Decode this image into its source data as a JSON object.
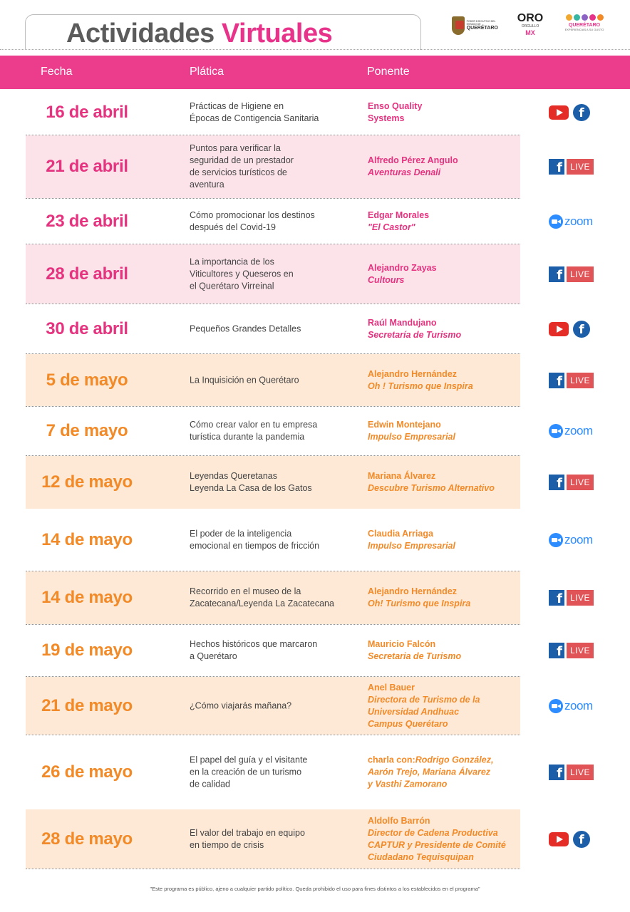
{
  "header": {
    "title_word1": "Actividades",
    "title_word2": "Virtuales",
    "logos": [
      {
        "name": "queretaro-gobierno-logo",
        "line1": "PODER EJECUTIVO DEL ESTADO DE",
        "line2": "QUERÉTARO"
      },
      {
        "name": "oro-orgullo-mx-logo",
        "line1": "ORO",
        "line2": "ORGULLO",
        "line3": "MX"
      },
      {
        "name": "queretaro-turismo-logo",
        "line1": "QUERÉTARO",
        "line2": "EXPERIENCIAS A SU GUSTO"
      }
    ]
  },
  "columns": {
    "fecha": "Fecha",
    "platica": "Plática",
    "ponente": "Ponente"
  },
  "colors": {
    "pink": "#ec3c8c",
    "orange": "#f28a28",
    "pink_bg": "#fce3ea",
    "orange_bg": "#fee9d6"
  },
  "rows": [
    {
      "date": "16 de abril",
      "talk": "Prácticas de Higiene en\nÉpocas de Contigencia Sanitaria",
      "speaker": [
        "Enso Quality",
        "Systems"
      ],
      "org": "",
      "platform": [
        "youtube-icon",
        "facebook-icon"
      ]
    },
    {
      "date": "21 de abril",
      "talk": "Puntos para verificar la\nseguridad de un prestador\nde servicios turísticos de\naventura",
      "speaker": [
        "Alfredo Pérez Angulo"
      ],
      "org": "Aventuras Denali",
      "platform": [
        "facebook-live-icon"
      ]
    },
    {
      "date": "23 de abril",
      "talk": "Cómo promocionar los destinos\ndespués del Covid-19",
      "speaker": [
        "Edgar Morales"
      ],
      "org": "\"El Castor\"",
      "platform": [
        "zoom-icon"
      ]
    },
    {
      "date": "28 de abril",
      "talk": "La importancia de los\nViticultores y Queseros en\nel Querétaro Virreinal",
      "speaker": [
        "Alejandro Zayas"
      ],
      "org": "Cultours",
      "platform": [
        "facebook-live-icon"
      ]
    },
    {
      "date": "30 de abril",
      "talk": "Pequeños Grandes Detalles",
      "speaker": [
        "Raúl Mandujano"
      ],
      "org": "Secretaría de Turismo",
      "platform": [
        "youtube-icon",
        "facebook-icon"
      ]
    },
    {
      "date": "5 de mayo",
      "talk": "La Inquisición en Querétaro",
      "speaker": [
        "Alejandro Hernández"
      ],
      "org": "Oh ! Turismo que Inspira",
      "platform": [
        "facebook-live-icon"
      ]
    },
    {
      "date": "7 de mayo",
      "talk": "Cómo crear valor en tu empresa\nturística durante la pandemia",
      "speaker": [
        "Edwin Montejano"
      ],
      "org": "Impulso Empresarial",
      "platform": [
        "zoom-icon"
      ]
    },
    {
      "date": "12 de mayo",
      "talk": "Leyendas Queretanas\nLeyenda La Casa de los Gatos",
      "speaker": [
        "Mariana Álvarez"
      ],
      "org": "Descubre Turismo Alternativo",
      "platform": [
        "facebook-live-icon"
      ]
    },
    {
      "date": "14 de mayo",
      "talk": "El poder de la inteligencia\nemocional en tiempos de fricción",
      "speaker": [
        "Claudia Arriaga"
      ],
      "org": "Impulso Empresarial",
      "platform": [
        "zoom-icon"
      ]
    },
    {
      "date": "14 de mayo",
      "talk": "Recorrido en el museo de la\nZacatecana/Leyenda La Zacatecana",
      "speaker": [
        "Alejandro Hernández"
      ],
      "org": "Oh! Turismo que Inspira",
      "platform": [
        "facebook-live-icon"
      ]
    },
    {
      "date": "19 de mayo",
      "talk": "Hechos históricos que marcaron\na Querétaro",
      "speaker": [
        "Mauricio Falcón"
      ],
      "org": "Secretaria de Turismo",
      "platform": [
        "facebook-live-icon"
      ]
    },
    {
      "date": "21 de mayo",
      "talk": "¿Cómo viajarás mañana?",
      "speaker": [
        "Anel Bauer"
      ],
      "org": "Directora de Turismo de la\nUniversidad Andhuac\nCampus Querétaro",
      "platform": [
        "zoom-icon"
      ]
    },
    {
      "date": "26 de mayo",
      "talk": "El papel del guía y el visitante\nen la creación de un turismo\nde calidad",
      "speaker": [
        "charla con:"
      ],
      "org": "Rodrigo González,\nAarón Trejo, Mariana Álvarez\ny Vasthi Zamorano",
      "platform": [
        "facebook-live-icon"
      ]
    },
    {
      "date": "28 de mayo",
      "talk": "El valor del trabajo en equipo\nen tiempo de crisis",
      "speaker": [
        "Aldolfo Barrón"
      ],
      "org": "Director de Cadena Productiva\nCAPTUR y Presidente de Comité\nCiudadano Tequisquipan",
      "platform": [
        "youtube-icon",
        "facebook-icon"
      ]
    }
  ],
  "platform_labels": {
    "live": "LIVE",
    "zoom": "zoom",
    "facebook_letter": "f"
  },
  "footnote": "\"Este programa es público, ajeno a cualquier partido político. Queda prohibido el uso para fines distintos a los establecidos en el programa\""
}
